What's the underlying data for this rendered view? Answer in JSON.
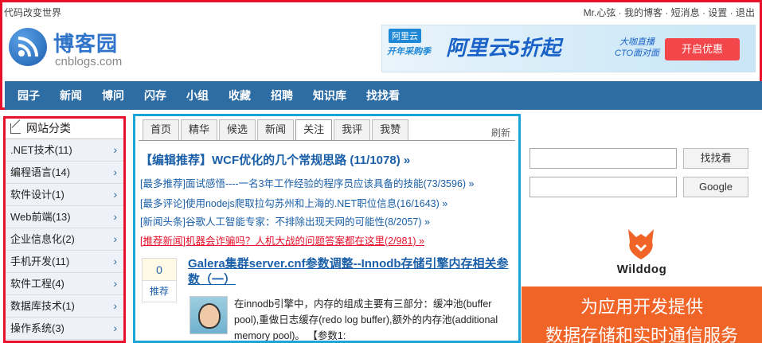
{
  "topbar": {
    "slogan": "代码改变世界",
    "links": "Mr.心弦 · 我的博客 · 短消息 · 设置 · 退出"
  },
  "logo": {
    "name": "博客园",
    "domain": "cnblogs.com"
  },
  "banner": {
    "brand": "阿里云",
    "badge": "开年采购季",
    "title": "阿里云5折起",
    "sub1": "大咖直播",
    "sub2": "CTO面对面",
    "cta": "开启优惠"
  },
  "nav": [
    "园子",
    "新闻",
    "博问",
    "闪存",
    "小组",
    "收藏",
    "招聘",
    "知识库",
    "找找看"
  ],
  "categories": {
    "title": "网站分类",
    "items": [
      ".NET技术(11)",
      "编程语言(14)",
      "软件设计(1)",
      "Web前端(13)",
      "企业信息化(2)",
      "手机开发(11)",
      "软件工程(4)",
      "数据库技术(1)",
      "操作系统(3)"
    ]
  },
  "tabs": [
    "首页",
    "精华",
    "候选",
    "新闻",
    "关注",
    "我评",
    "我赞"
  ],
  "active_tab": "关注",
  "refresh_label": "刷新",
  "headline": "【编辑推荐】WCF优化的几个常规思路 (11/1078) »",
  "sublinks": [
    "[最多推荐]面试感悟----一名3年工作经验的程序员应该具备的技能(73/3596) »",
    "[最多评论]使用nodejs爬取拉勾苏州和上海的.NET职位信息(16/1643) »",
    "[新闻头条]谷歌人工智能专家：不排除出现天网的可能性(8/2057) »",
    "[推荐新闻]机器会诈骗吗？人机大战的问题答案都在这里(2/981) »"
  ],
  "post": {
    "votes": "0",
    "vote_label": "推荐",
    "title": "Galera集群server.cnf参数调整--Innodb存储引擎内存相关参数（一）",
    "excerpt": "在innodb引擎中，内存的组成主要有三部分：缓冲池(buffer pool),重做日志缓存(redo log buffer),额外的内存池(additional memory pool)。 【参数1:"
  },
  "search": {
    "zzk_button": "找找看",
    "google_button": "Google"
  },
  "ad": {
    "brand": "Wilddog",
    "line1": "为应用开发提供",
    "line2": "数据存储和实时通信服务"
  },
  "colors": {
    "nav": "#2e6ca4",
    "highlight_red": "#e8102a",
    "highlight_cyan": "#1aa5d6",
    "ad_orange": "#f06428"
  }
}
